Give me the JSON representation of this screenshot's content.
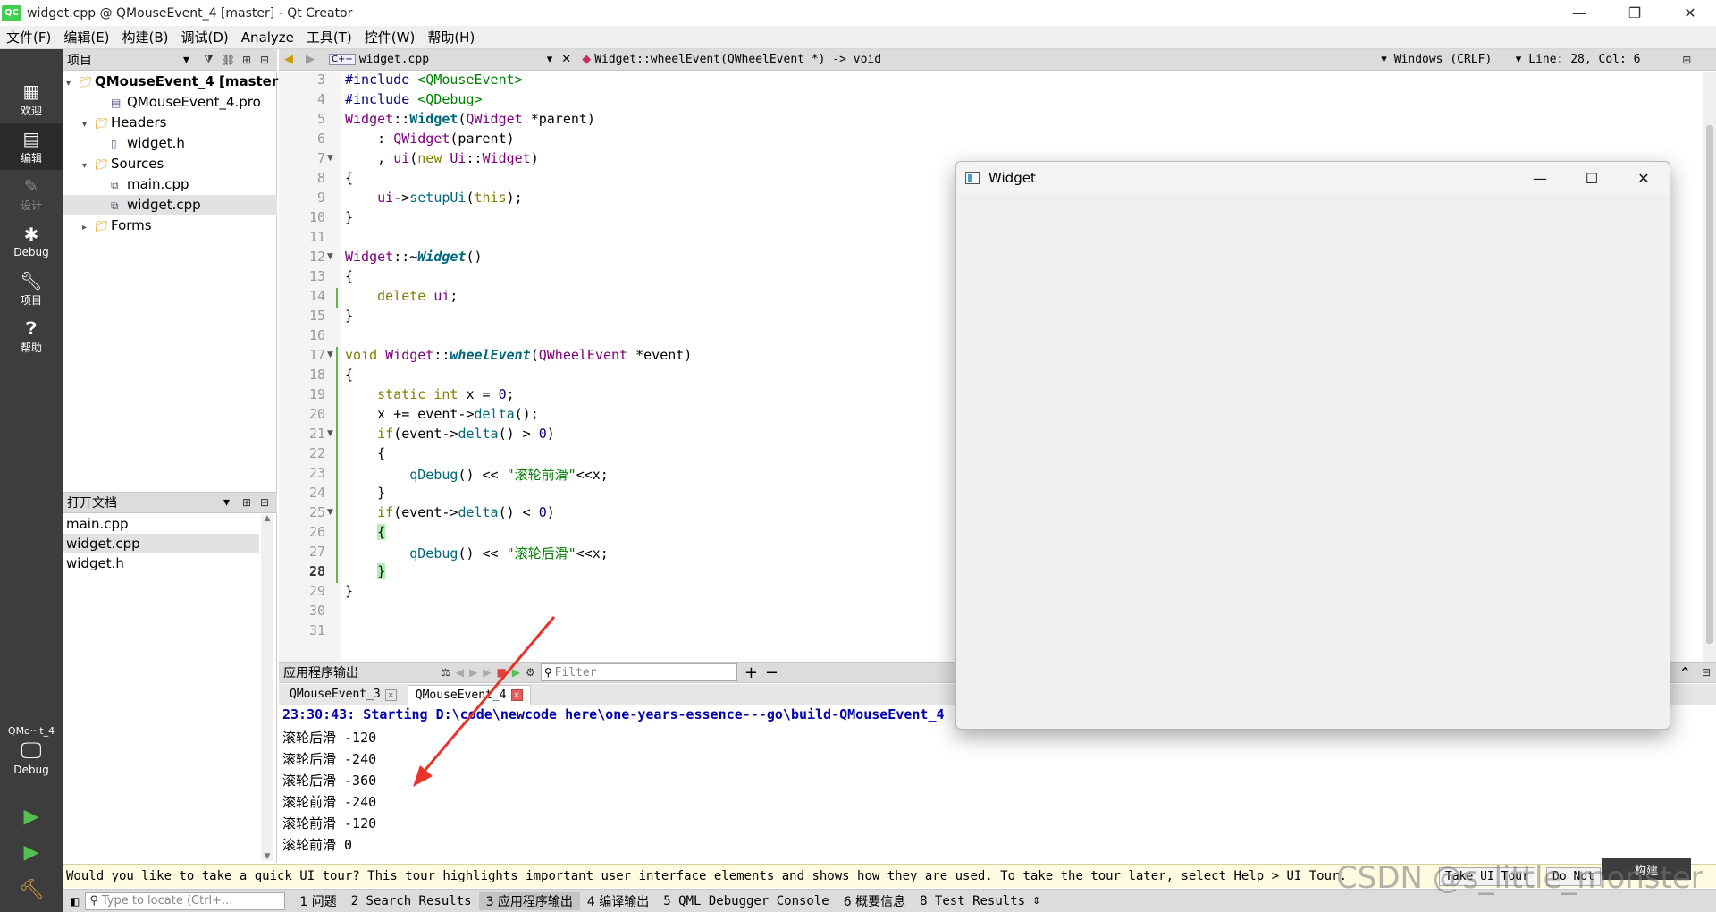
{
  "window": {
    "title": "widget.cpp @ QMouseEvent_4 [master] - Qt Creator",
    "app_icon": "QC"
  },
  "menu": [
    "文件(F)",
    "编辑(E)",
    "构建(B)",
    "调试(D)",
    "Analyze",
    "工具(T)",
    "控件(W)",
    "帮助(H)"
  ],
  "modes": [
    {
      "label": "欢迎",
      "icon": "grid-icon"
    },
    {
      "label": "编辑",
      "icon": "edit-icon"
    },
    {
      "label": "设计",
      "icon": "pencil-icon"
    },
    {
      "label": "Debug",
      "icon": "bug-icon"
    },
    {
      "label": "项目",
      "icon": "wrench-icon"
    },
    {
      "label": "帮助",
      "icon": "help-icon"
    }
  ],
  "kit": {
    "name": "QMo···t_4",
    "mode": "Debug"
  },
  "project_panel": {
    "header": "项目",
    "tree": [
      {
        "label": "QMouseEvent_4 [master]",
        "bold": true,
        "indent": 0,
        "arrow": "▾",
        "icon": "📁"
      },
      {
        "label": "QMouseEvent_4.pro",
        "indent": 2,
        "arrow": "",
        "icon": "▤"
      },
      {
        "label": "Headers",
        "indent": 1,
        "arrow": "▾",
        "icon": "📁"
      },
      {
        "label": "widget.h",
        "indent": 2,
        "arrow": "",
        "icon": "h"
      },
      {
        "label": "Sources",
        "indent": 1,
        "arrow": "▾",
        "icon": "📁"
      },
      {
        "label": "main.cpp",
        "indent": 2,
        "arrow": "",
        "icon": "c"
      },
      {
        "label": "widget.cpp",
        "indent": 2,
        "arrow": "",
        "icon": "c",
        "selected": true
      },
      {
        "label": "Forms",
        "indent": 1,
        "arrow": "▸",
        "icon": "📁"
      }
    ]
  },
  "open_docs": {
    "header": "打开文档",
    "items": [
      {
        "label": "main.cpp"
      },
      {
        "label": "widget.cpp",
        "selected": true
      },
      {
        "label": "widget.h"
      }
    ]
  },
  "editor": {
    "file_tab": "widget.cpp",
    "symbol": "Widget::wheelEvent(QWheelEvent *) -> void",
    "line_ending": "Windows (CRLF)",
    "position": "Line: 28, Col: 6",
    "current_line": 28,
    "lines": [
      {
        "n": 3,
        "html": "<span class='pp'>#include</span> <span class='st'>&lt;QMouseEvent&gt;</span>"
      },
      {
        "n": 4,
        "html": "<span class='pp'>#include</span> <span class='st'>&lt;QDebug&gt;</span>"
      },
      {
        "n": 5,
        "html": "<span class='ty'>Widget</span>::<span class='fnb'>Widget</span>(<span class='ty'>QWidget</span> *parent)"
      },
      {
        "n": 6,
        "html": "    : <span class='ty'>QWidget</span>(parent)"
      },
      {
        "n": 7,
        "html": "    , <span class='ty'>ui</span>(<span class='kw'>new</span> <span class='ty'>Ui</span>::<span class='ty'>Widget</span>)",
        "fold": true
      },
      {
        "n": 8,
        "html": "{"
      },
      {
        "n": 9,
        "html": "    <span class='ty'>ui</span>-&gt;<span class='fn'>setupUi</span>(<span class='kw'>this</span>);"
      },
      {
        "n": 10,
        "html": "}"
      },
      {
        "n": 11,
        "html": ""
      },
      {
        "n": 12,
        "html": "<span class='ty'>Widget</span>::~<span class='fnbi'>Widget</span>()",
        "fold": true
      },
      {
        "n": 13,
        "html": "{"
      },
      {
        "n": 14,
        "html": "    <span class='kw'>delete</span> <span class='ty'>ui</span>;"
      },
      {
        "n": 15,
        "html": "}"
      },
      {
        "n": 16,
        "html": ""
      },
      {
        "n": 17,
        "html": "<span class='kw'>void</span> <span class='ty'>Widget</span>::<span class='fnbi'>wheelEvent</span>(<span class='ty'>QWheelEvent</span> *event)",
        "fold": true
      },
      {
        "n": 18,
        "html": "{"
      },
      {
        "n": 19,
        "html": "    <span class='kw'>static</span> <span class='kw'>int</span> x = <span class='nm'>0</span>;"
      },
      {
        "n": 20,
        "html": "    x += event-&gt;<span class='fn'>delta</span>();"
      },
      {
        "n": 21,
        "html": "    <span class='kw'>if</span>(event-&gt;<span class='fn'>delta</span>() &gt; <span class='nm'>0</span>)",
        "fold": true
      },
      {
        "n": 22,
        "html": "    {"
      },
      {
        "n": 23,
        "html": "        <span class='fn'>qDebug</span>() &lt;&lt; <span class='st'>\"滚轮前滑\"</span>&lt;&lt;x;"
      },
      {
        "n": 24,
        "html": "    }"
      },
      {
        "n": 25,
        "html": "    <span class='kw'>if</span>(event-&gt;<span class='fn'>delta</span>() &lt; <span class='nm'>0</span>)",
        "fold": true
      },
      {
        "n": 26,
        "html": "    <span class='br'>{</span>"
      },
      {
        "n": 27,
        "html": "        <span class='fn'>qDebug</span>() &lt;&lt; <span class='st'>\"滚轮后滑\"</span>&lt;&lt;x;"
      },
      {
        "n": 28,
        "html": "    <span class='br'>}</span>"
      },
      {
        "n": 29,
        "html": "}"
      },
      {
        "n": 30,
        "html": ""
      },
      {
        "n": 31,
        "html": ""
      }
    ]
  },
  "output_panel": {
    "header": "应用程序输出",
    "filter_placeholder": "Filter",
    "tabs": [
      {
        "label": "QMouseEvent_3",
        "active": false
      },
      {
        "label": "QMouseEvent_4",
        "active": true
      }
    ],
    "start_line": "23:30:43: Starting D:\\code\\newcode here\\one-years-essence---go\\build-QMouseEvent_4",
    "lines": [
      "滚轮后滑 -120",
      "滚轮后滑 -240",
      "滚轮后滑 -360",
      "滚轮前滑 -240",
      "滚轮前滑 -120",
      "滚轮前滑 0"
    ]
  },
  "tour": {
    "text": "Would you like to take a quick UI tour? This tour highlights important user interface elements and shows how they are used. To take the tour later, select Help > UI Tour.",
    "take_label": "Take UI Tour",
    "dismiss_label": "Do Not"
  },
  "build_label": "构建",
  "statusbar": {
    "locate_placeholder": "Type to locate (Ctrl+...",
    "panes": [
      "1 问题",
      "2 Search Results",
      "3 应用程序输出",
      "4 编译输出",
      "5 QML Debugger Console",
      "6 概要信息",
      "8 Test Results"
    ]
  },
  "widget_window": {
    "title": "Widget"
  },
  "watermark": "CSDN @s_little_monster",
  "colors": {
    "accent": "#41cd52",
    "arrow": "#e8332a"
  }
}
